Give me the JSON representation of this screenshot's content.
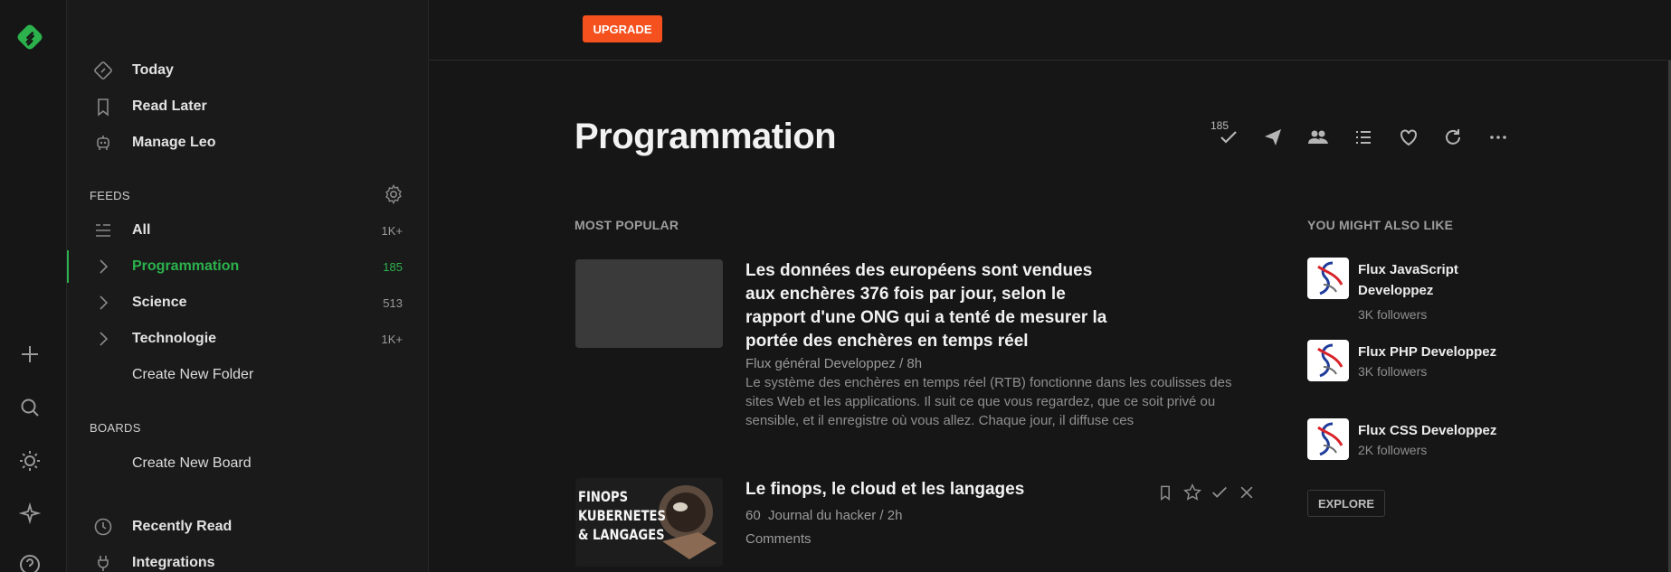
{
  "colors": {
    "accent": "#2bb24c",
    "upgrade": "#f4511e",
    "background": "#161616"
  },
  "rail": {
    "logo": "feedly-logo",
    "icons": [
      "add-icon",
      "search-icon",
      "theme-icon",
      "ai-sparkle-icon",
      "help-icon"
    ]
  },
  "sidebar": {
    "top_items": [
      {
        "label": "Today",
        "icon": "today-icon"
      },
      {
        "label": "Read Later",
        "icon": "bookmark-icon"
      },
      {
        "label": "Manage Leo",
        "icon": "leo-robot-icon"
      }
    ],
    "feeds_label": "FEEDS",
    "feeds": [
      {
        "label": "All",
        "count": "1K+",
        "icon": "list-icon"
      },
      {
        "label": "Programmation",
        "count": "185",
        "icon": "chevron-right-icon",
        "active": true
      },
      {
        "label": "Science",
        "count": "513",
        "icon": "chevron-right-icon"
      },
      {
        "label": "Technologie",
        "count": "1K+",
        "icon": "chevron-right-icon"
      }
    ],
    "create_folder": "Create New Folder",
    "boards_label": "BOARDS",
    "create_board": "Create New Board",
    "bottom_items": [
      {
        "label": "Recently Read",
        "icon": "clock-icon"
      },
      {
        "label": "Integrations",
        "icon": "plug-icon"
      }
    ]
  },
  "topbar": {
    "upgrade_label": "UPGRADE"
  },
  "main": {
    "title": "Programmation",
    "unread_count": "185",
    "toolbar_icons": [
      "mark-read-icon",
      "share-icon",
      "team-icon",
      "list-view-icon",
      "heart-icon",
      "refresh-icon",
      "more-icon"
    ],
    "most_popular_label": "MOST POPULAR",
    "articles": [
      {
        "title": "Les données des européens sont vendues aux enchères 376 fois par jour, selon le rapport d'une ONG qui a tenté de mesurer la portée des enchères en temps réel",
        "meta": "Flux général Developpez / 8h",
        "summary": "Le système des enchères en temps réel (RTB) fonctionne dans les coulisses des sites Web et les applications. Il suit ce que vous regardez, que ce soit privé ou sensible, et il enregistre où vous allez. Chaque jour, il diffuse ces"
      },
      {
        "title": "Le finops, le cloud et les langages",
        "meta_count": "60",
        "meta": "Journal du hacker / 2h",
        "comments": "Comments",
        "thumb_text": [
          "FINOPS",
          "KUBERNETES",
          "& LANGAGES"
        ]
      }
    ],
    "article_actions": [
      "bookmark-icon",
      "star-icon",
      "check-icon",
      "close-icon"
    ]
  },
  "recommendations": {
    "label": "YOU MIGHT ALSO LIKE",
    "items": [
      {
        "name": "Flux JavaScript Developpez",
        "followers": "3K followers"
      },
      {
        "name": "Flux PHP Developpez",
        "followers": "3K followers"
      },
      {
        "name": "Flux CSS Developpez",
        "followers": "2K followers"
      }
    ],
    "explore_label": "EXPLORE"
  }
}
